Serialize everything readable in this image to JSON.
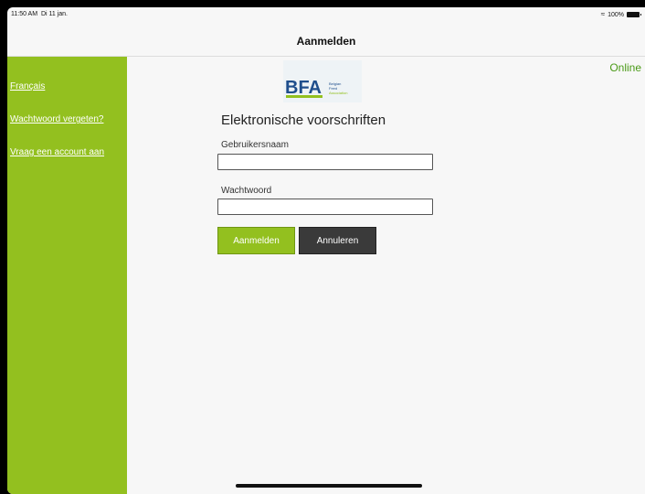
{
  "status": {
    "time": "11:50 AM",
    "date": "Di 11 jan.",
    "battery": "100%"
  },
  "navbar": {
    "title": "Aanmelden"
  },
  "sidebar": {
    "items": [
      {
        "label": "Français"
      },
      {
        "label": "Wachtwoord vergeten?"
      },
      {
        "label": "Vraag een account aan"
      }
    ]
  },
  "connection": {
    "status": "Online"
  },
  "logo": {
    "brand": "BFA",
    "lines": [
      "Belgian",
      "Feed",
      "Association"
    ]
  },
  "form": {
    "title": "Elektronische voorschriften",
    "username_label": "Gebruikersnaam",
    "username_value": "",
    "password_label": "Wachtwoord",
    "password_value": "",
    "login_button": "Aanmelden",
    "cancel_button": "Annuleren"
  },
  "colors": {
    "accent": "#93c01f",
    "dark": "#3a3a3a",
    "online": "#4a9a17"
  }
}
